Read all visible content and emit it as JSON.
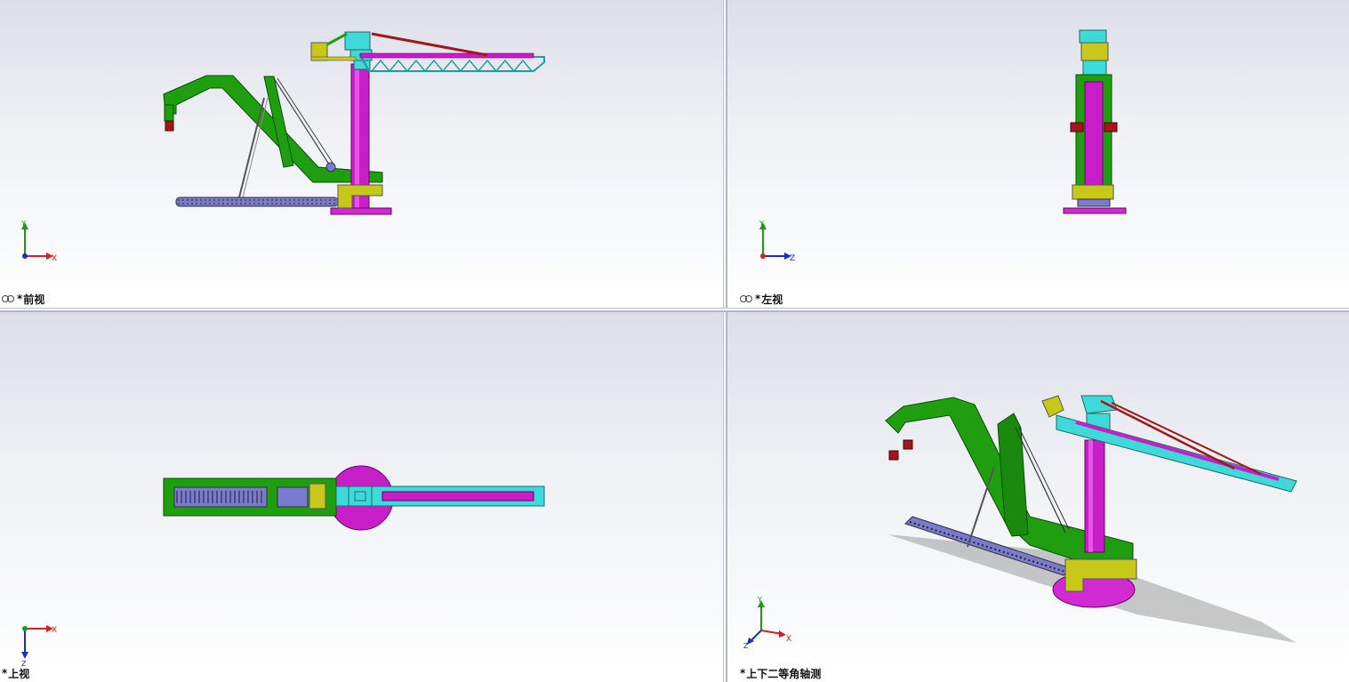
{
  "viewports": {
    "front": {
      "star": "*",
      "name": "前视",
      "axes": {
        "horizontal": "X",
        "vertical": "Y"
      }
    },
    "left": {
      "star": "*",
      "name": "左视",
      "axes": {
        "horizontal": "Z",
        "vertical": "Y"
      }
    },
    "top": {
      "star": "*",
      "name": "上视",
      "axes": {
        "horizontal": "X",
        "vertical": "Z"
      }
    },
    "iso": {
      "star": "*",
      "name": "上下二等角轴测",
      "axes": {
        "horizontal": "X",
        "vertical": "Y",
        "depth": "Z"
      }
    }
  },
  "colors": {
    "boom": "#1f9e10",
    "boom_dark": "#0b5a06",
    "column": "#c81ec8",
    "column_light": "#f06cf0",
    "head": "#3fd9d9",
    "block": "#c8c81a",
    "bucket": "#a01818",
    "chain": "#7a7ad0",
    "axis_x": "#d42020",
    "axis_y": "#1a9c1a",
    "axis_z": "#1a2ccc"
  },
  "icons": {
    "view_link": "link-icon"
  }
}
